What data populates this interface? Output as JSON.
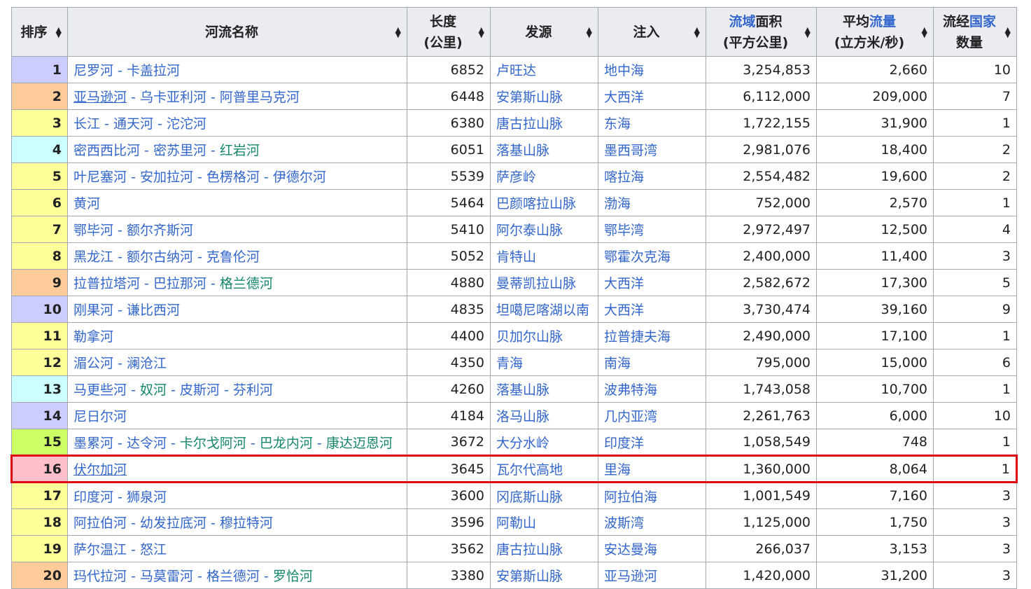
{
  "headers": {
    "rank": "排序",
    "name": "河流名称",
    "length_l1": "长度",
    "length_l2": "(公里)",
    "source": "发源",
    "mouth": "注入",
    "basin_l1a": "流域",
    "basin_l1b": "面积",
    "basin_l2": "(平方公里)",
    "flow_l1a": "平均",
    "flow_l1b": "流量",
    "flow_l2": "(立方米/秒)",
    "countries_l1a": "流经",
    "countries_l1b": "国家",
    "countries_l2": "数量"
  },
  "rank_colors": {
    "violet": "#ccccff",
    "orange": "#ffcc99",
    "yellow": "#ffff99",
    "cyan": "#ccffff",
    "lime": "#ccff66",
    "pink": "#ffc0cb"
  },
  "highlight_color": "#e0000f",
  "rows": [
    {
      "rank": "1",
      "color": "violet",
      "name": [
        {
          "t": "尼罗河",
          "s": "lnk"
        },
        {
          "t": "卡盖拉河",
          "s": "lnk"
        }
      ],
      "length": "6852",
      "source": "卢旺达",
      "mouth": "地中海",
      "basin": "3,254,853",
      "flow": "2,660",
      "countries": "10"
    },
    {
      "rank": "2",
      "color": "orange",
      "name": [
        {
          "t": "亚马逊河",
          "s": "lnk-u"
        },
        {
          "t": "乌卡亚利河",
          "s": "lnk"
        },
        {
          "t": "阿普里马克河",
          "s": "lnk"
        }
      ],
      "length": "6448",
      "source": "安第斯山脉",
      "mouth": "大西洋",
      "basin": "6,112,000",
      "flow": "209,000",
      "countries": "7"
    },
    {
      "rank": "3",
      "color": "yellow",
      "name": [
        {
          "t": "长江",
          "s": "lnk"
        },
        {
          "t": "通天河",
          "s": "lnk"
        },
        {
          "t": "沱沱河",
          "s": "lnk"
        }
      ],
      "length": "6380",
      "source": "唐古拉山脉",
      "mouth": "东海",
      "basin": "1,722,155",
      "flow": "31,900",
      "countries": "1"
    },
    {
      "rank": "4",
      "color": "cyan",
      "name": [
        {
          "t": "密西西比河",
          "s": "lnk"
        },
        {
          "t": "密苏里河",
          "s": "lnk"
        },
        {
          "t": "红岩河",
          "s": "lnk-g"
        }
      ],
      "length": "6051",
      "source": "落基山脉",
      "mouth": "墨西哥湾",
      "basin": "2,981,076",
      "flow": "18,400",
      "countries": "2"
    },
    {
      "rank": "5",
      "color": "yellow",
      "name": [
        {
          "t": "叶尼塞河",
          "s": "lnk"
        },
        {
          "t": "安加拉河",
          "s": "lnk"
        },
        {
          "t": "色楞格河",
          "s": "lnk"
        },
        {
          "t": "伊德尔河",
          "s": "lnk"
        }
      ],
      "length": "5539",
      "source": "萨彦岭",
      "mouth": "喀拉海",
      "basin": "2,554,482",
      "flow": "19,600",
      "countries": "2"
    },
    {
      "rank": "6",
      "color": "yellow",
      "name": [
        {
          "t": "黄河",
          "s": "lnk"
        }
      ],
      "length": "5464",
      "source": "巴颜喀拉山脉",
      "mouth": "渤海",
      "basin": "752,000",
      "flow": "2,570",
      "countries": "1"
    },
    {
      "rank": "7",
      "color": "yellow",
      "name": [
        {
          "t": "鄂毕河",
          "s": "lnk"
        },
        {
          "t": "额尔齐斯河",
          "s": "lnk"
        }
      ],
      "length": "5410",
      "source": "阿尔泰山脉",
      "mouth": "鄂毕湾",
      "basin": "2,972,497",
      "flow": "12,500",
      "countries": "4"
    },
    {
      "rank": "8",
      "color": "yellow",
      "name": [
        {
          "t": "黑龙江",
          "s": "lnk"
        },
        {
          "t": "额尔古纳河",
          "s": "lnk"
        },
        {
          "t": "克鲁伦河",
          "s": "lnk"
        }
      ],
      "length": "5052",
      "source": "肯特山",
      "mouth": "鄂霍次克海",
      "basin": "2,400,000",
      "flow": "11,400",
      "countries": "3"
    },
    {
      "rank": "9",
      "color": "orange",
      "name": [
        {
          "t": "拉普拉塔河",
          "s": "lnk"
        },
        {
          "t": "巴拉那河",
          "s": "lnk"
        },
        {
          "t": "格兰德河",
          "s": "lnk-g"
        }
      ],
      "length": "4880",
      "source": "曼蒂凯拉山脉",
      "mouth": "大西洋",
      "basin": "2,582,672",
      "flow": "17,300",
      "countries": "5"
    },
    {
      "rank": "10",
      "color": "violet",
      "name": [
        {
          "t": "刚果河",
          "s": "lnk"
        },
        {
          "t": "谦比西河",
          "s": "lnk"
        }
      ],
      "length": "4835",
      "source": "坦噶尼喀湖以南",
      "mouth": "大西洋",
      "basin": "3,730,474",
      "flow": "39,160",
      "countries": "9"
    },
    {
      "rank": "11",
      "color": "yellow",
      "name": [
        {
          "t": "勒拿河",
          "s": "lnk"
        }
      ],
      "length": "4400",
      "source": "贝加尔山脉",
      "mouth": "拉普捷夫海",
      "basin": "2,490,000",
      "flow": "17,100",
      "countries": "1"
    },
    {
      "rank": "12",
      "color": "yellow",
      "name": [
        {
          "t": "湄公河",
          "s": "lnk"
        },
        {
          "t": "澜沧江",
          "s": "lnk"
        }
      ],
      "length": "4350",
      "source": "青海",
      "mouth": "南海",
      "basin": "795,000",
      "flow": "15,000",
      "countries": "6"
    },
    {
      "rank": "13",
      "color": "cyan",
      "name": [
        {
          "t": "马更些河",
          "s": "lnk"
        },
        {
          "t": "奴河",
          "s": "lnk-g"
        },
        {
          "t": "皮斯河",
          "s": "lnk"
        },
        {
          "t": "芬利河",
          "s": "lnk"
        }
      ],
      "length": "4260",
      "source": "落基山脉",
      "mouth": "波弗特海",
      "basin": "1,743,058",
      "flow": "10,700",
      "countries": "1"
    },
    {
      "rank": "14",
      "color": "violet",
      "name": [
        {
          "t": "尼日尔河",
          "s": "lnk"
        }
      ],
      "length": "4184",
      "source": "洛马山脉",
      "mouth": "几内亚湾",
      "basin": "2,261,763",
      "flow": "6,000",
      "countries": "10"
    },
    {
      "rank": "15",
      "color": "lime",
      "name": [
        {
          "t": "墨累河",
          "s": "lnk"
        },
        {
          "t": "达令河",
          "s": "lnk"
        },
        {
          "t": "卡尔戈阿河",
          "s": "lnk-g"
        },
        {
          "t": "巴龙内河",
          "s": "lnk-g"
        },
        {
          "t": "康达迈恩河",
          "s": "lnk-g"
        }
      ],
      "length": "3672",
      "source": "大分水岭",
      "mouth": "印度洋",
      "basin": "1,058,549",
      "flow": "748",
      "countries": "1"
    },
    {
      "rank": "16",
      "color": "pink",
      "highlight": true,
      "name": [
        {
          "t": "伏尔加河",
          "s": "lnk-u"
        }
      ],
      "length": "3645",
      "source": "瓦尔代高地",
      "mouth": "里海",
      "basin": "1,360,000",
      "flow": "8,064",
      "countries": "1"
    },
    {
      "rank": "17",
      "color": "yellow",
      "name": [
        {
          "t": "印度河",
          "s": "lnk"
        },
        {
          "t": "狮泉河",
          "s": "lnk"
        }
      ],
      "length": "3600",
      "source": "冈底斯山脉",
      "mouth": "阿拉伯海",
      "basin": "1,001,549",
      "flow": "7,160",
      "countries": "3"
    },
    {
      "rank": "18",
      "color": "yellow",
      "name": [
        {
          "t": "阿拉伯河",
          "s": "lnk"
        },
        {
          "t": "幼发拉底河",
          "s": "lnk"
        },
        {
          "t": "穆拉特河",
          "s": "lnk"
        }
      ],
      "length": "3596",
      "source": "阿勒山",
      "mouth": "波斯湾",
      "basin": "1,125,000",
      "flow": "1,750",
      "countries": "3"
    },
    {
      "rank": "19",
      "color": "yellow",
      "name": [
        {
          "t": "萨尔温江",
          "s": "lnk"
        },
        {
          "t": "怒江",
          "s": "lnk"
        }
      ],
      "length": "3562",
      "source": "唐古拉山脉",
      "mouth": "安达曼海",
      "basin": "266,037",
      "flow": "3,153",
      "countries": "3"
    },
    {
      "rank": "20",
      "color": "orange",
      "name": [
        {
          "t": "玛代拉河",
          "s": "lnk"
        },
        {
          "t": "马莫雷河",
          "s": "lnk"
        },
        {
          "t": "格兰德河",
          "s": "lnk"
        },
        {
          "t": "罗恰河",
          "s": "lnk-g"
        }
      ],
      "length": "3380",
      "source": "安第斯山脉",
      "mouth": "亚马逊河",
      "basin": "1,420,000",
      "flow": "31,200",
      "countries": "3"
    }
  ],
  "name_separator": " - "
}
